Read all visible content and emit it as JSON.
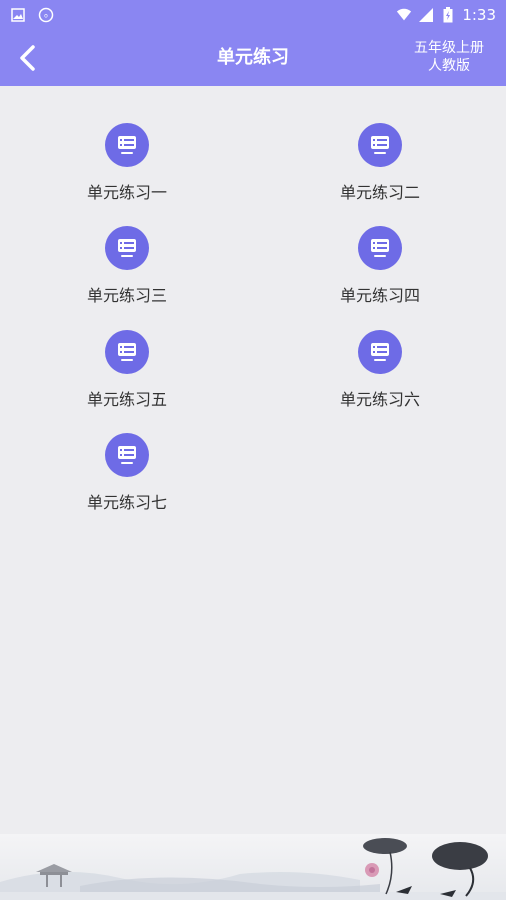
{
  "status_bar": {
    "time": "1:33",
    "icons": [
      "image-icon",
      "app-icon",
      "wifi-icon",
      "signal-icon",
      "battery-icon"
    ]
  },
  "app_bar": {
    "title": "单元练习",
    "subtitle_line1": "五年级上册",
    "subtitle_line2": "人教版"
  },
  "units": [
    {
      "label": "单元练习一"
    },
    {
      "label": "单元练习二"
    },
    {
      "label": "单元练习三"
    },
    {
      "label": "单元练习四"
    },
    {
      "label": "单元练习五"
    },
    {
      "label": "单元练习六"
    },
    {
      "label": "单元练习七"
    }
  ],
  "colors": {
    "header": "#8a86f2",
    "icon_circle": "#6e6be6",
    "background": "#ededf0"
  }
}
